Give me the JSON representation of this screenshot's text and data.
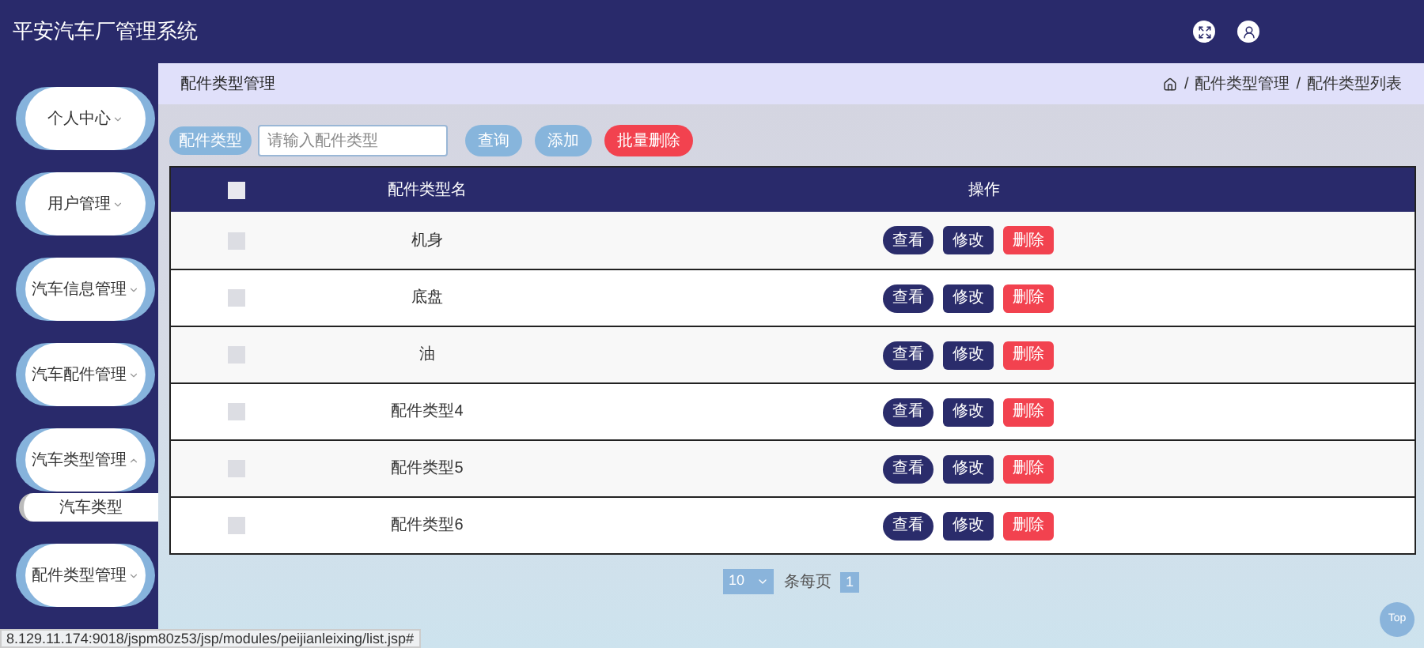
{
  "app_title": "平安汽车厂管理系统",
  "sidebar": {
    "items": [
      {
        "label": "个人中心",
        "expanded": false
      },
      {
        "label": "用户管理",
        "expanded": false
      },
      {
        "label": "汽车信息管理",
        "expanded": false
      },
      {
        "label": "汽车配件管理",
        "expanded": false
      },
      {
        "label": "汽车类型管理",
        "expanded": true,
        "children": [
          {
            "label": "汽车类型"
          }
        ]
      },
      {
        "label": "配件类型管理",
        "expanded": false
      }
    ]
  },
  "breadcrumb": {
    "title": "配件类型管理",
    "separator": "/",
    "path": [
      "配件类型管理",
      "配件类型列表"
    ]
  },
  "search": {
    "label": "配件类型",
    "placeholder": "请输入配件类型"
  },
  "toolbar_buttons": [
    {
      "label": "查询",
      "kind": "primary"
    },
    {
      "label": "添加",
      "kind": "primary"
    },
    {
      "label": "批量删除",
      "kind": "danger"
    }
  ],
  "table": {
    "columns": [
      "配件类型名",
      "操作"
    ],
    "select_all_checked": false,
    "rows": [
      {
        "name": "机身",
        "checked": false,
        "actions": [
          {
            "label": "查看",
            "kind": "view"
          },
          {
            "label": "修改",
            "kind": "edit"
          },
          {
            "label": "删除",
            "kind": "delete"
          }
        ]
      },
      {
        "name": "底盘",
        "checked": false,
        "actions": [
          {
            "label": "查看",
            "kind": "view"
          },
          {
            "label": "修改",
            "kind": "edit"
          },
          {
            "label": "删除",
            "kind": "delete"
          }
        ]
      },
      {
        "name": "油",
        "checked": false,
        "actions": [
          {
            "label": "查看",
            "kind": "view"
          },
          {
            "label": "修改",
            "kind": "edit"
          },
          {
            "label": "删除",
            "kind": "delete"
          }
        ]
      },
      {
        "name": "配件类型4",
        "checked": false,
        "actions": [
          {
            "label": "查看",
            "kind": "view"
          },
          {
            "label": "修改",
            "kind": "edit"
          },
          {
            "label": "删除",
            "kind": "delete"
          }
        ]
      },
      {
        "name": "配件类型5",
        "checked": false,
        "actions": [
          {
            "label": "查看",
            "kind": "view"
          },
          {
            "label": "修改",
            "kind": "edit"
          },
          {
            "label": "删除",
            "kind": "delete"
          }
        ]
      },
      {
        "name": "配件类型6",
        "checked": false,
        "actions": [
          {
            "label": "查看",
            "kind": "view"
          },
          {
            "label": "修改",
            "kind": "edit"
          },
          {
            "label": "删除",
            "kind": "delete"
          }
        ]
      }
    ]
  },
  "pagination": {
    "page_size": "10",
    "page_size_label": "条每页",
    "pages": [
      {
        "label": "1",
        "selected": true
      }
    ]
  },
  "back_to_top": "Top",
  "status_url": "8.129.11.174:9018/jspm80z53/jsp/modules/peijianleixing/list.jsp#"
}
